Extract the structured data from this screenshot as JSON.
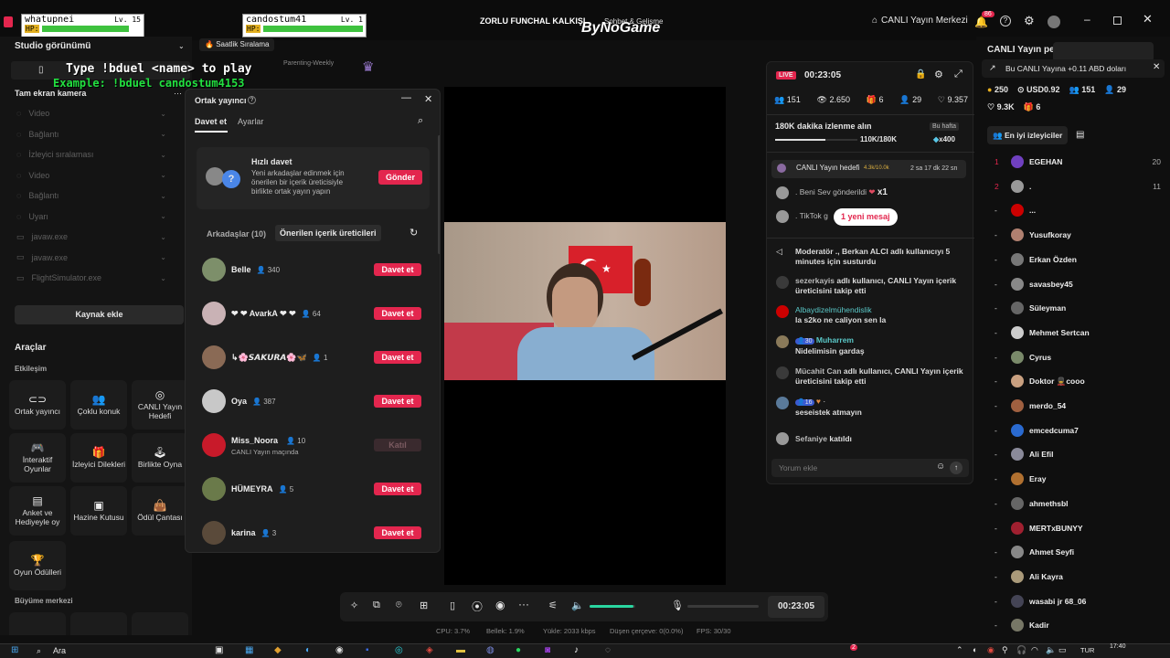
{
  "top": {
    "player1": {
      "name": "whatupnei",
      "level": "Lv. 15",
      "hp": "HP:"
    },
    "player2": {
      "name": "candostum41",
      "level": "Lv. 1",
      "hp": "HP:"
    },
    "headline": "ZORLU FUNCHAL KALKIŞI",
    "watermark": "ByNoGame",
    "subtitle": "Sohbet & Gelişme",
    "live_center": "CANLI Yayın Merkezi",
    "notif_count": "86"
  },
  "overlay": {
    "line1": "Type !bduel <name> to play",
    "line2": "Example: !bduel candostum4153",
    "hourly": "Saatlik Sıralama",
    "ranking_small": "Parenting-Weekly"
  },
  "left": {
    "studio": "Studio görünümü",
    "fullscreen": "Tam ekran kamera",
    "sources": [
      "Video",
      "Bağlantı",
      "İzleyici sıralaması",
      "Video",
      "Bağlantı",
      "Uyarı",
      "javaw.exe",
      "javaw.exe",
      "FlightSimulator.exe"
    ],
    "add_source": "Kaynak ekle",
    "tools_title": "Araçlar",
    "interaction": "Etkileşim",
    "tools": [
      "Ortak yayıncı",
      "Çoklu konuk",
      "CANLI Yayın Hedefi",
      "İnteraktif Oyunlar",
      "İzleyici Dilekleri",
      "Birlikte Oyna",
      "Anket ve Hediyeyle oy",
      "Hazine Kutusu",
      "Ödül Çantası",
      "Oyun Ödülleri"
    ],
    "growth": "Büyüme merkezi"
  },
  "popup": {
    "title": "Ortak yayıncı",
    "tab_invite": "Davet et",
    "tab_settings": "Ayarlar",
    "quick_title": "Hızlı davet",
    "quick_desc": "Yeni arkadaşlar edinmek için önerilen bir içerik üreticisiyle birlikte ortak yayın yapın",
    "send": "Gönder",
    "friends_tab": "Arkadaşlar (10)",
    "suggested_tab": "Önerilen içerik üreticileri",
    "people": [
      {
        "name": "Belle",
        "count": "340",
        "action": "Davet et",
        "color": "#7d8f6a"
      },
      {
        "name": "❤ ❤ AvarkA ❤ ❤",
        "count": "64",
        "action": "Davet et",
        "color": "#c9b2b5"
      },
      {
        "name": "↳🌸𝙎𝘼𝙆𝙐𝙍𝘼🌸🦋",
        "count": "1",
        "action": "Davet et",
        "color": "#8a6a55"
      },
      {
        "name": "Oya",
        "count": "387",
        "action": "Davet et",
        "color": "#c8c8c8"
      },
      {
        "name": "Miss_Noora",
        "count": "10",
        "action": "Katıl",
        "sub": "CANLI Yayın maçında",
        "color": "#c81a2a"
      },
      {
        "name": "HÜMEYRA",
        "count": "5",
        "action": "Davet et",
        "color": "#6a7a4a"
      },
      {
        "name": "karina",
        "count": "3",
        "action": "Davet et",
        "color": "#5a4a3a"
      }
    ]
  },
  "toolbar": {
    "timer": "00:23:05"
  },
  "status": {
    "cpu": "CPU: 3.7%",
    "mem": "Bellek: 1.9%",
    "upload": "Yükle: 2033 kbps",
    "dropped": "Düşen çerçeve: 0(0.0%)",
    "fps": "FPS: 30/30"
  },
  "live": {
    "badge": "LIVE",
    "timer": "00:23:05",
    "stats": {
      "viewers": "151",
      "views": "2.650",
      "gifts": "6",
      "members": "29",
      "likes": "9.357"
    },
    "goal_title": "180K dakika izlenme alın",
    "goal_badge": "Bu hafta",
    "goal_progress": "110K/180K",
    "goal_progress_value": 0.61,
    "goal_reward": "x400",
    "target_label": "CANLI Yayın hedefi",
    "target_value": "4.3k/10.0k",
    "target_time": "2 sa 17 dk 22 sn",
    "gift_line": ". Beni Sev gönderildi",
    "gift_mult": "x1",
    "tiktok_line": ". TikTok g",
    "new_msg": "1 yeni mesaj",
    "chat": [
      {
        "user": "Moderatör ., Berkan ALCI",
        "text": "adlı kullanıcıyı 5 minutes için susturdu",
        "color": "#e04a4a"
      },
      {
        "user": "sezerkayis",
        "text": "adlı kullanıcı, CANLI Yayın içerik üreticisini takip etti",
        "color": "#888"
      },
      {
        "user": "Albaydizelmühendislik",
        "text": "la s2ko ne caliyon sen la",
        "color": "#c00"
      },
      {
        "user": "Muharrem",
        "level": "30",
        "text": "Nidelimisin gardaş",
        "color": "#8a7a5a"
      },
      {
        "user": "Mücahit Can",
        "text": "adlı kullanıcı, CANLI Yayın içerik üreticisini takip etti",
        "color": "#888"
      },
      {
        "user": "",
        "level": "16",
        "text": "seseistek atmayın",
        "color": "#5a7a9a"
      },
      {
        "user": "Sefaniye",
        "text": "katıldı",
        "color": "#999"
      }
    ],
    "comment_placeholder": "Yorum ekle"
  },
  "right": {
    "title": "CANLI Yayın pe",
    "toast": "Bu CANLI Yayına +0.11 ABD doları",
    "stats": {
      "coins": "250",
      "usd": "USD0.92",
      "viewers": "151",
      "members": "29",
      "likes": "9.3K",
      "gifts": "6"
    },
    "top_viewers_tab": "En iyi izleyiciler",
    "viewers": [
      {
        "rank": "1",
        "name": "EGEHAN",
        "score": "20",
        "color": "#7040c0"
      },
      {
        "rank": "2",
        "name": ".",
        "score": "11",
        "color": "#999"
      },
      {
        "rank": "-",
        "name": "...",
        "score": "",
        "color": "#c00"
      },
      {
        "rank": "-",
        "name": "Yusufkoray",
        "score": "",
        "color": "#b08070"
      },
      {
        "rank": "-",
        "name": "Erkan Özden",
        "score": "",
        "color": "#777"
      },
      {
        "rank": "-",
        "name": "savasbey45",
        "score": "",
        "color": "#888"
      },
      {
        "rank": "-",
        "name": "Süleyman",
        "score": "",
        "color": "#666"
      },
      {
        "rank": "-",
        "name": "Mehmet Sertcan",
        "score": "",
        "color": "#ccc"
      },
      {
        "rank": "-",
        "name": "Cyrus",
        "score": "",
        "color": "#7a8a6a"
      },
      {
        "rank": "-",
        "name": "Doktor 💂cooo",
        "score": "",
        "color": "#c9a080"
      },
      {
        "rank": "-",
        "name": "merdo_54",
        "score": "",
        "color": "#a06040"
      },
      {
        "rank": "-",
        "name": "emcedcuma7",
        "score": "",
        "color": "#2a6ad0"
      },
      {
        "rank": "-",
        "name": "Ali Efil",
        "score": "",
        "color": "#8a8a9a"
      },
      {
        "rank": "-",
        "name": "Eray",
        "score": "",
        "color": "#b07030"
      },
      {
        "rank": "-",
        "name": "ahmethsbl",
        "score": "",
        "color": "#666"
      },
      {
        "rank": "-",
        "name": "MERTxBUNYY",
        "score": "",
        "color": "#a02030"
      },
      {
        "rank": "-",
        "name": "Ahmet Seyfi",
        "score": "",
        "color": "#888"
      },
      {
        "rank": "-",
        "name": "Ali Kayra",
        "score": "",
        "color": "#aa9a7a"
      },
      {
        "rank": "-",
        "name": "wasabi jr 68_06",
        "score": "",
        "color": "#445"
      },
      {
        "rank": "-",
        "name": "Kadir",
        "score": "",
        "color": "#776"
      }
    ]
  },
  "taskbar": {
    "search": "Ara",
    "lang": "TUR",
    "time": "17:40",
    "badge": "2"
  }
}
